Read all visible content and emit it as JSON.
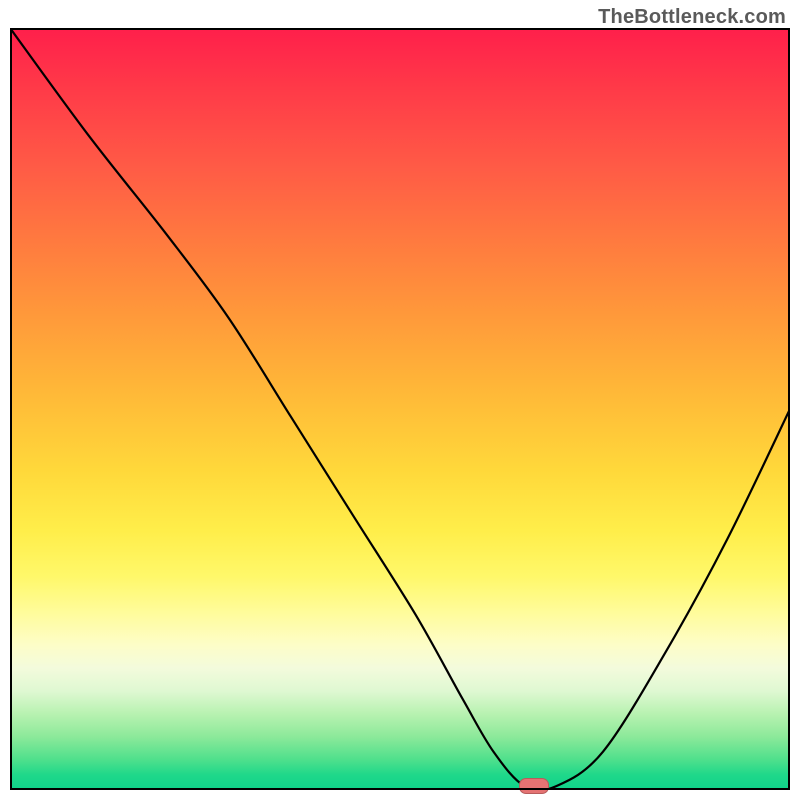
{
  "watermark": "TheBottleneck.com",
  "chart_data": {
    "type": "line",
    "title": "",
    "xlabel": "",
    "ylabel": "",
    "xlim": [
      0,
      1
    ],
    "ylim": [
      0,
      1
    ],
    "grid": false,
    "legend": false,
    "background_gradient": {
      "type": "vertical",
      "stops": [
        {
          "pos": 0.0,
          "color": "#ff1f4b"
        },
        {
          "pos": 0.4,
          "color": "#ff9a3a"
        },
        {
          "pos": 0.66,
          "color": "#ffee4a"
        },
        {
          "pos": 0.82,
          "color": "#fdfdc8"
        },
        {
          "pos": 0.92,
          "color": "#8ce99a"
        },
        {
          "pos": 1.0,
          "color": "#0fd28a"
        }
      ]
    },
    "series": [
      {
        "name": "bottleneck-curve",
        "color": "#000000",
        "x": [
          0.0,
          0.1,
          0.2,
          0.28,
          0.36,
          0.44,
          0.52,
          0.58,
          0.62,
          0.66,
          0.7,
          0.76,
          0.84,
          0.92,
          1.0
        ],
        "y": [
          1.0,
          0.86,
          0.73,
          0.62,
          0.49,
          0.36,
          0.23,
          0.12,
          0.05,
          0.005,
          0.005,
          0.05,
          0.18,
          0.33,
          0.5
        ]
      }
    ],
    "marker": {
      "name": "optimal-point",
      "x": 0.67,
      "y": 0.003,
      "color": "#e57373"
    },
    "note": "x and y are normalized 0..1 in chart space; y=0 is bottom, y=1 is top. Values estimated from pixels."
  }
}
